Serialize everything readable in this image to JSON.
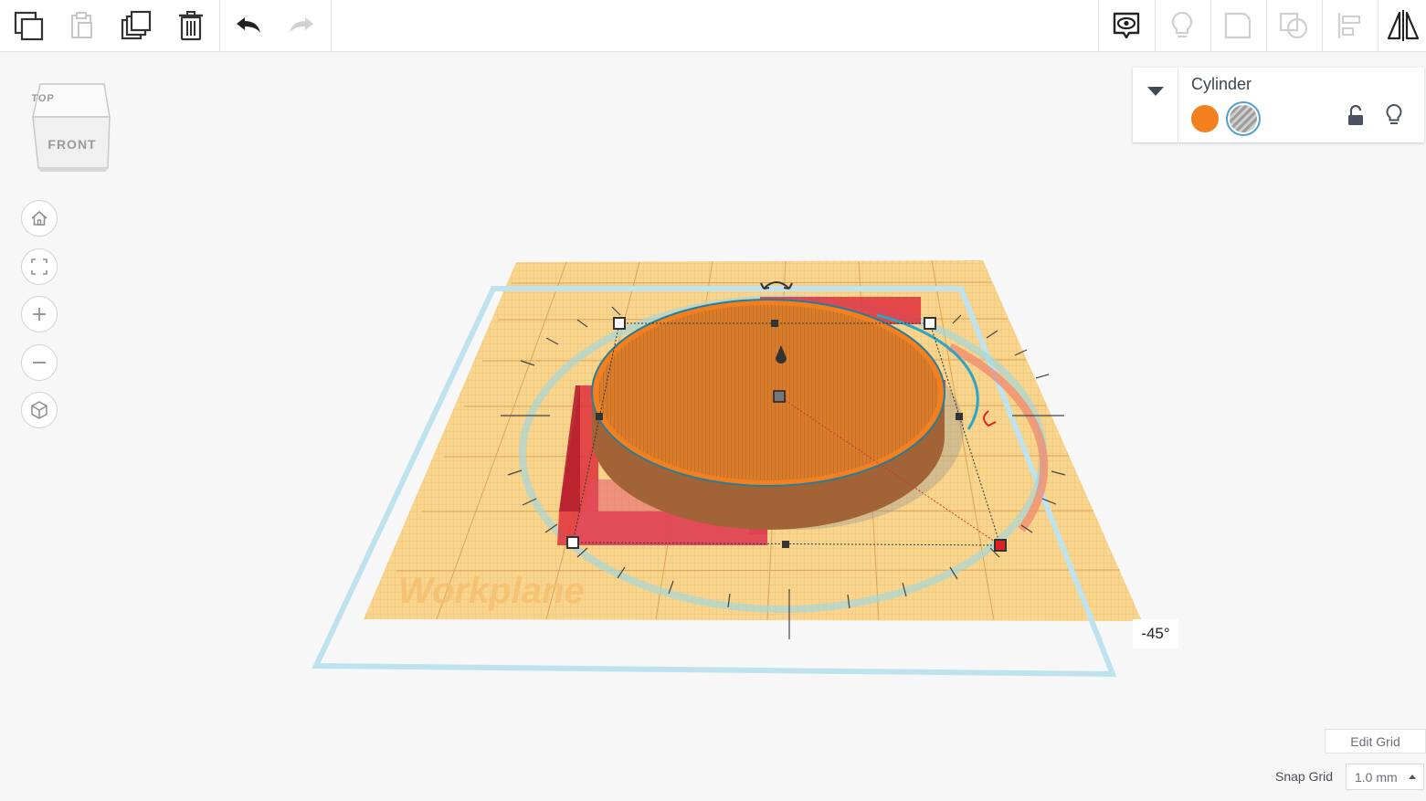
{
  "toolbar": {
    "left": [
      {
        "name": "copy-icon",
        "label": "Copy"
      },
      {
        "name": "paste-icon",
        "label": "Paste"
      },
      {
        "name": "duplicate-icon",
        "label": "Duplicate"
      },
      {
        "name": "delete-icon",
        "label": "Delete"
      },
      {
        "name": "undo-icon",
        "label": "Undo"
      },
      {
        "name": "redo-icon",
        "label": "Redo"
      }
    ],
    "right": [
      {
        "name": "show-all-icon",
        "label": "Show all"
      },
      {
        "name": "hide-icon",
        "label": "Hide"
      },
      {
        "name": "group-icon",
        "label": "Group"
      },
      {
        "name": "ungroup-icon",
        "label": "Ungroup"
      },
      {
        "name": "align-icon",
        "label": "Align"
      },
      {
        "name": "mirror-icon",
        "label": "Mirror"
      }
    ]
  },
  "viewcube": {
    "top": "TOP",
    "front": "FRONT"
  },
  "nav": [
    "home-icon",
    "fit-view-icon",
    "zoom-in-icon",
    "zoom-out-icon",
    "perspective-icon"
  ],
  "inspector": {
    "title": "Cylinder",
    "solid_color": "#f47f1e",
    "hole_color": "#a0a0a0",
    "selected": "hole"
  },
  "scene": {
    "workplane_label": "Workplane",
    "rotation_angle": "-45°"
  },
  "edit_grid_label": "Edit Grid",
  "snap_grid": {
    "label": "Snap Grid",
    "value": "1.0 mm"
  },
  "colors": {
    "workplane": "#f8d48c",
    "selection": "#2aa6c9",
    "red_box": "#e0303c",
    "orange": "#f47f1e"
  }
}
